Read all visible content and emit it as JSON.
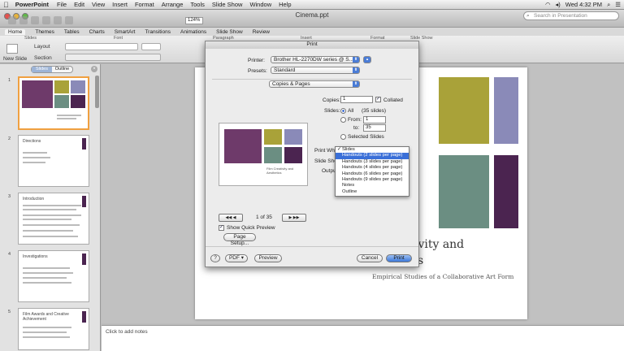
{
  "menubar": {
    "app": "PowerPoint",
    "items": [
      "File",
      "Edit",
      "View",
      "Insert",
      "Format",
      "Arrange",
      "Tools",
      "Slide Show",
      "Window",
      "Help"
    ],
    "clock": "Wed 4:32 PM"
  },
  "window": {
    "title": "Cinema.ppt",
    "search_placeholder": "Search in Presentation",
    "zoom": "124%"
  },
  "ribbon": {
    "tabs": [
      "Home",
      "Themes",
      "Tables",
      "Charts",
      "SmartArt",
      "Transitions",
      "Animations",
      "Slide Show",
      "Review"
    ],
    "groups": [
      "Slides",
      "Font",
      "Paragraph",
      "Insert",
      "Format",
      "Slide Show"
    ],
    "new_slide": "New Slide",
    "layout": "Layout",
    "section": "Section"
  },
  "sidebar": {
    "seg_slides": "Slides",
    "seg_outline": "Outline",
    "thumbs": [
      {
        "num": "1",
        "title": ""
      },
      {
        "num": "2",
        "title": "Directions"
      },
      {
        "num": "3",
        "title": "Introduction"
      },
      {
        "num": "4",
        "title": "Investigations"
      },
      {
        "num": "5",
        "title": "Film Awards and Creative Achievement"
      }
    ]
  },
  "slide": {
    "title_line1": "ativity and",
    "title_line2": "s",
    "subtitle": "Empirical Studies of a Collaborative Art Form",
    "colors": {
      "purple": "#6e3a6a",
      "olive": "#a9a239",
      "lavender": "#8a8ab8",
      "teal": "#6b8e82",
      "dark": "#4b2450"
    }
  },
  "notes": {
    "placeholder": "Click to add notes"
  },
  "dialog": {
    "title": "Print",
    "printer_label": "Printer:",
    "printer_value": "Brother HL-2270DW series @ S...",
    "presets_label": "Presets:",
    "presets_value": "Standard",
    "section_value": "Copies & Pages",
    "copies_label": "Copies:",
    "copies_value": "1",
    "collated_label": "Collated",
    "slides_label": "Slides:",
    "all_label": "All",
    "all_count": "(35 slides)",
    "from_label": "From:",
    "from_value": "1",
    "to_label": "to:",
    "to_value": "35",
    "selected_label": "Selected Slides",
    "print_what_label": "Print What",
    "slide_show_label": "Slide Show",
    "output_label": "Output",
    "page_indicator": "1 of 35",
    "quick_preview_label": "Show Quick Preview",
    "page_setup_label": "Page Setup...",
    "help_label": "?",
    "pdf_label": "PDF ▾",
    "preview_label": "Preview",
    "cancel_label": "Cancel",
    "print_label": "Print",
    "preview_caption1": "Film Creativity and",
    "preview_caption2": "Aesthetics"
  },
  "print_what_menu": {
    "items": [
      "Slides",
      "Handouts (2 slides per page)",
      "Handouts (3 slides per page)",
      "Handouts (4 slides per page)",
      "Handouts (6 slides per page)",
      "Handouts (9 slides per page)",
      "Notes",
      "Outline"
    ],
    "checked_index": 0,
    "highlight_index": 1
  }
}
